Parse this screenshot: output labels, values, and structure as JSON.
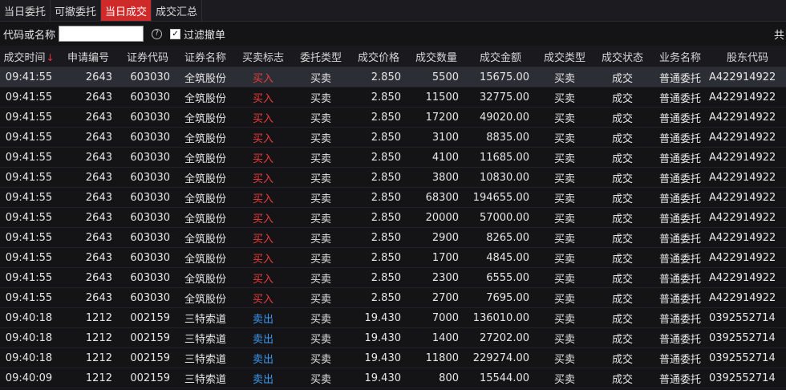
{
  "tabs": [
    {
      "label": "当日委托",
      "active": false
    },
    {
      "label": "可撤委托",
      "active": false
    },
    {
      "label": "当日成交",
      "active": true
    },
    {
      "label": "成交汇总",
      "active": false
    }
  ],
  "filter": {
    "code_label": "代码或名称",
    "code_value": "",
    "help_glyph": "?",
    "filter_cancel_label": "过滤撤单",
    "filter_cancel_checked": true,
    "right_label": "共"
  },
  "table": {
    "sort_indicator": "↓",
    "columns": [
      "成交时间",
      "申请编号",
      "证券代码",
      "证券名称",
      "买卖标志",
      "委托类型",
      "成交价格",
      "成交数量",
      "成交金额",
      "成交类型",
      "成交状态",
      "业务名称",
      "股东代码"
    ],
    "rows": [
      {
        "time": "09:41:55",
        "req": "2643",
        "code": "603030",
        "name": "全筑股份",
        "side": "买入",
        "type": "买卖",
        "price": "2.850",
        "qty": "5500",
        "amount": "15675.00",
        "deal_type": "买卖",
        "status": "成交",
        "biz": "普通委托",
        "holder": "A422914922"
      },
      {
        "time": "09:41:55",
        "req": "2643",
        "code": "603030",
        "name": "全筑股份",
        "side": "买入",
        "type": "买卖",
        "price": "2.850",
        "qty": "11500",
        "amount": "32775.00",
        "deal_type": "买卖",
        "status": "成交",
        "biz": "普通委托",
        "holder": "A422914922"
      },
      {
        "time": "09:41:55",
        "req": "2643",
        "code": "603030",
        "name": "全筑股份",
        "side": "买入",
        "type": "买卖",
        "price": "2.850",
        "qty": "17200",
        "amount": "49020.00",
        "deal_type": "买卖",
        "status": "成交",
        "biz": "普通委托",
        "holder": "A422914922"
      },
      {
        "time": "09:41:55",
        "req": "2643",
        "code": "603030",
        "name": "全筑股份",
        "side": "买入",
        "type": "买卖",
        "price": "2.850",
        "qty": "3100",
        "amount": "8835.00",
        "deal_type": "买卖",
        "status": "成交",
        "biz": "普通委托",
        "holder": "A422914922"
      },
      {
        "time": "09:41:55",
        "req": "2643",
        "code": "603030",
        "name": "全筑股份",
        "side": "买入",
        "type": "买卖",
        "price": "2.850",
        "qty": "4100",
        "amount": "11685.00",
        "deal_type": "买卖",
        "status": "成交",
        "biz": "普通委托",
        "holder": "A422914922"
      },
      {
        "time": "09:41:55",
        "req": "2643",
        "code": "603030",
        "name": "全筑股份",
        "side": "买入",
        "type": "买卖",
        "price": "2.850",
        "qty": "3800",
        "amount": "10830.00",
        "deal_type": "买卖",
        "status": "成交",
        "biz": "普通委托",
        "holder": "A422914922"
      },
      {
        "time": "09:41:55",
        "req": "2643",
        "code": "603030",
        "name": "全筑股份",
        "side": "买入",
        "type": "买卖",
        "price": "2.850",
        "qty": "68300",
        "amount": "194655.00",
        "deal_type": "买卖",
        "status": "成交",
        "biz": "普通委托",
        "holder": "A422914922"
      },
      {
        "time": "09:41:55",
        "req": "2643",
        "code": "603030",
        "name": "全筑股份",
        "side": "买入",
        "type": "买卖",
        "price": "2.850",
        "qty": "20000",
        "amount": "57000.00",
        "deal_type": "买卖",
        "status": "成交",
        "biz": "普通委托",
        "holder": "A422914922"
      },
      {
        "time": "09:41:55",
        "req": "2643",
        "code": "603030",
        "name": "全筑股份",
        "side": "买入",
        "type": "买卖",
        "price": "2.850",
        "qty": "2900",
        "amount": "8265.00",
        "deal_type": "买卖",
        "status": "成交",
        "biz": "普通委托",
        "holder": "A422914922"
      },
      {
        "time": "09:41:55",
        "req": "2643",
        "code": "603030",
        "name": "全筑股份",
        "side": "买入",
        "type": "买卖",
        "price": "2.850",
        "qty": "1700",
        "amount": "4845.00",
        "deal_type": "买卖",
        "status": "成交",
        "biz": "普通委托",
        "holder": "A422914922"
      },
      {
        "time": "09:41:55",
        "req": "2643",
        "code": "603030",
        "name": "全筑股份",
        "side": "买入",
        "type": "买卖",
        "price": "2.850",
        "qty": "2300",
        "amount": "6555.00",
        "deal_type": "买卖",
        "status": "成交",
        "biz": "普通委托",
        "holder": "A422914922"
      },
      {
        "time": "09:41:55",
        "req": "2643",
        "code": "603030",
        "name": "全筑股份",
        "side": "买入",
        "type": "买卖",
        "price": "2.850",
        "qty": "2700",
        "amount": "7695.00",
        "deal_type": "买卖",
        "status": "成交",
        "biz": "普通委托",
        "holder": "A422914922"
      },
      {
        "time": "09:40:18",
        "req": "1212",
        "code": "002159",
        "name": "三特索道",
        "side": "卖出",
        "type": "买卖",
        "price": "19.430",
        "qty": "7000",
        "amount": "136010.00",
        "deal_type": "买卖",
        "status": "成交",
        "biz": "普通委托",
        "holder": "0392552714"
      },
      {
        "time": "09:40:18",
        "req": "1212",
        "code": "002159",
        "name": "三特索道",
        "side": "卖出",
        "type": "买卖",
        "price": "19.430",
        "qty": "1400",
        "amount": "27202.00",
        "deal_type": "买卖",
        "status": "成交",
        "biz": "普通委托",
        "holder": "0392552714"
      },
      {
        "time": "09:40:18",
        "req": "1212",
        "code": "002159",
        "name": "三特索道",
        "side": "卖出",
        "type": "买卖",
        "price": "19.430",
        "qty": "11800",
        "amount": "229274.00",
        "deal_type": "买卖",
        "status": "成交",
        "biz": "普通委托",
        "holder": "0392552714"
      },
      {
        "time": "09:40:09",
        "req": "1212",
        "code": "002159",
        "name": "三特索道",
        "side": "卖出",
        "type": "买卖",
        "price": "19.430",
        "qty": "800",
        "amount": "15544.00",
        "deal_type": "买卖",
        "status": "成交",
        "biz": "普通委托",
        "holder": "0392552714"
      }
    ]
  },
  "colors": {
    "buy": "#ef3b3b",
    "sell": "#3a98f2",
    "active_tab": "#cf2a2a"
  }
}
